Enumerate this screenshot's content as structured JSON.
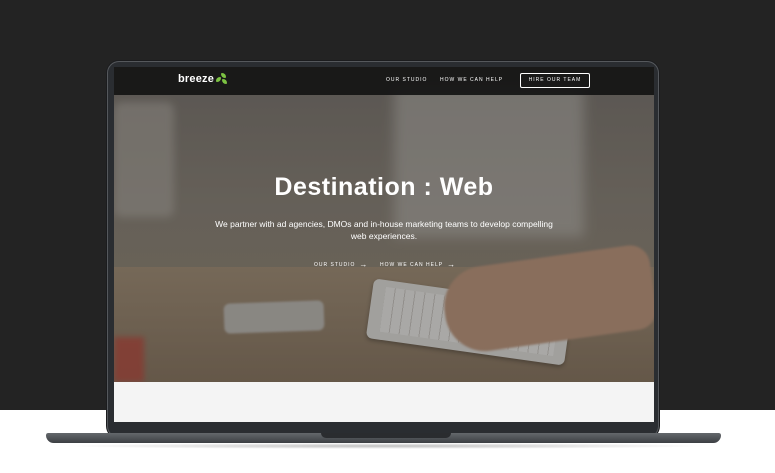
{
  "site": {
    "logo_text": "breeze",
    "brand_color": "#7cc242"
  },
  "nav": {
    "items": [
      {
        "label": "OUR STUDIO"
      },
      {
        "label": "HOW WE CAN HELP"
      }
    ],
    "cta_label": "HIRE OUR TEAM"
  },
  "hero": {
    "title": "Destination : Web",
    "subtitle": "We partner with ad agencies, DMOs and in-house marketing teams to develop compelling web experiences.",
    "links": [
      {
        "label": "OUR STUDIO",
        "icon": "arrow-right-icon"
      },
      {
        "label": "HOW WE CAN HELP",
        "icon": "arrow-right-icon"
      }
    ]
  }
}
